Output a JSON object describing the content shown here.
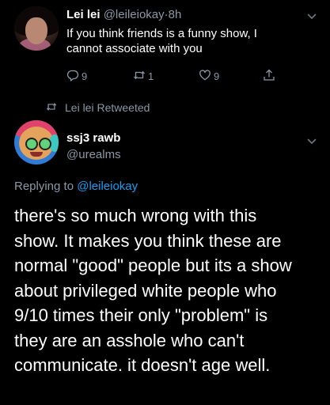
{
  "retweeted_tweet": {
    "display_name": "Lei lei",
    "handle": "@leileiokay",
    "separator": "·",
    "time": "8h",
    "text_lines": [
      "If you think friends is a funny show, I",
      "cannot associate with you"
    ],
    "actions": {
      "reply_count": "9",
      "retweet_count": "1",
      "like_count": "9"
    }
  },
  "retweet_label": "Lei lei Retweeted",
  "reply_tweet": {
    "display_name": "ssj3 rawb",
    "handle": "@urealms",
    "replying_prefix": "Replying to",
    "replying_handle": "@leileiokay",
    "text_lines": [
      "there's so much wrong with this",
      "show. It makes you think these are",
      "normal \"good\" people but its a show",
      "about privileged white people who",
      "9/10 times their only \"problem\" is",
      "they are an asshole who can't",
      "communicate. it doesn't age well."
    ]
  },
  "icons": {
    "reply": "reply-icon",
    "retweet": "retweet-icon",
    "like": "heart-icon",
    "share": "share-icon",
    "caret": "chevron-down-icon"
  },
  "colors": {
    "background": "#000000",
    "primary_text": "#ffffff",
    "secondary_text": "#8b98a5",
    "link": "#1d9bf0"
  }
}
